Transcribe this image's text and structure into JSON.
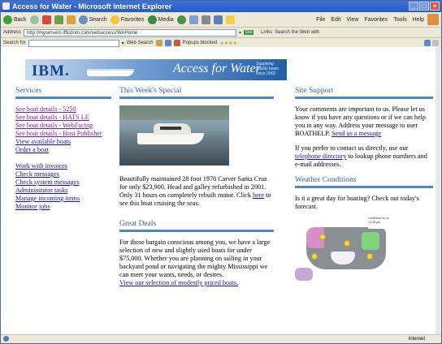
{
  "window": {
    "title": "Access for Water - Microsoft Internet Explorer"
  },
  "toolbar": {
    "back": "Back",
    "search": "Search",
    "favorites": "Favorites",
    "media": "Media",
    "menus": [
      "File",
      "Edit",
      "View",
      "Favorites",
      "Tools",
      "Help"
    ]
  },
  "address": {
    "label": "Address",
    "url": "http://myservers.ifficdom.com/webaccess/WAHome",
    "go": "Go",
    "links": "Links",
    "search_web": "Search the Web with"
  },
  "search_bar": {
    "label": "Search for",
    "web_search": "Web Search",
    "popups": "Popups blocked"
  },
  "banner": {
    "logo": "IBM.",
    "title": "Access for Water",
    "tagline": "Supplying quality boats since 2002"
  },
  "services": {
    "heading": "Services",
    "links1": [
      "See boat details - 5250",
      "See boat details - HATS LE",
      "See boat details - WebFacing",
      "See boat details - Host Publisher",
      "View available boats",
      "Order a boat"
    ],
    "links2": [
      "Work with invoices",
      "Check messages",
      "Check system messages",
      "Administrator tasks",
      "Manage incoming items",
      "Monitor jobs"
    ]
  },
  "special": {
    "heading": "This Week's Special",
    "text_before": "Beautifully maintained 28 foot 1978 Carver Santa Cruz for only $23,900. Head and galley refurbished in 2001. Only 31 hours on completely rebuilt motor. Click ",
    "link": "here",
    "text_after": " to see this boat cruising the seas."
  },
  "deals": {
    "heading": "Great Deals",
    "text": "For those bargain conscious among you, we have a large selection of new and slightly used boats for under $75,000. Whether you are planning on sailing in your backyard pond or navigating the mighty Mississippi we can meet your wants, needs, or desires.",
    "link": "View our selection of modestly priced boats."
  },
  "support": {
    "heading": "Site Support",
    "text1": "Your comments are important to us. Please let us know if you have any questions or if we can help you in any way. Address your message to user BOATHELP.",
    "link1": "Send us a message",
    "text2_before": "If you prefer to contact us directly, use our ",
    "link2": "telephone directory",
    "text2_after": " to lookup phone numbers and e-mail addresses."
  },
  "weather": {
    "heading": "Weather Conditions",
    "text": "Is it a great day for boating? Check out today's forecast.",
    "legend": "conditions as of: 12:40 pm"
  },
  "status": {
    "zone": "Internet"
  },
  "colors": {
    "heading": "#2f63b4",
    "rule": "#4a88c8",
    "link": "#1111cc",
    "visited": "#7b1aa5"
  }
}
